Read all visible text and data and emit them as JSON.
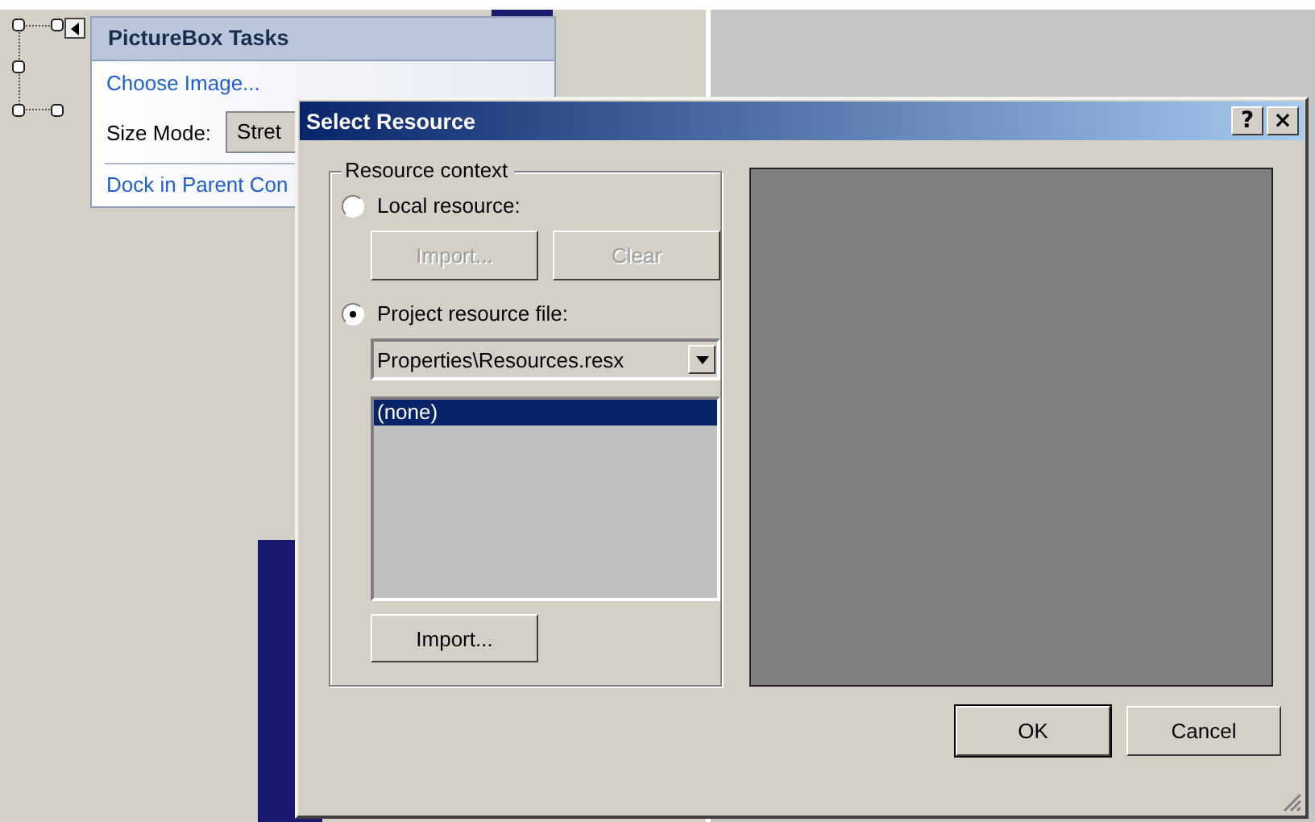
{
  "designer": {
    "tasks_panel": {
      "title": "PictureBox Tasks",
      "choose_link": "Choose Image...",
      "size_mode_label": "Size Mode:",
      "size_mode_value": "Stret",
      "dock_link": "Dock in Parent Con"
    }
  },
  "dialog": {
    "title": "Select Resource",
    "title_buttons": [
      "?",
      "×"
    ],
    "group": {
      "legend": "Resource context",
      "options": [
        {
          "label": "Local resource:",
          "selected": false
        },
        {
          "label": "Project resource file:",
          "selected": true
        }
      ],
      "local_buttons": [
        {
          "label": "Import...",
          "disabled": true
        },
        {
          "label": "Clear",
          "disabled": true
        }
      ],
      "resource_file": "Properties\\Resources.resx",
      "resources": [
        {
          "label": "(none)",
          "selected": true
        }
      ],
      "import_button": "Import..."
    },
    "buttons": [
      {
        "label": "OK",
        "default": true
      },
      {
        "label": "Cancel",
        "default": false
      }
    ]
  }
}
